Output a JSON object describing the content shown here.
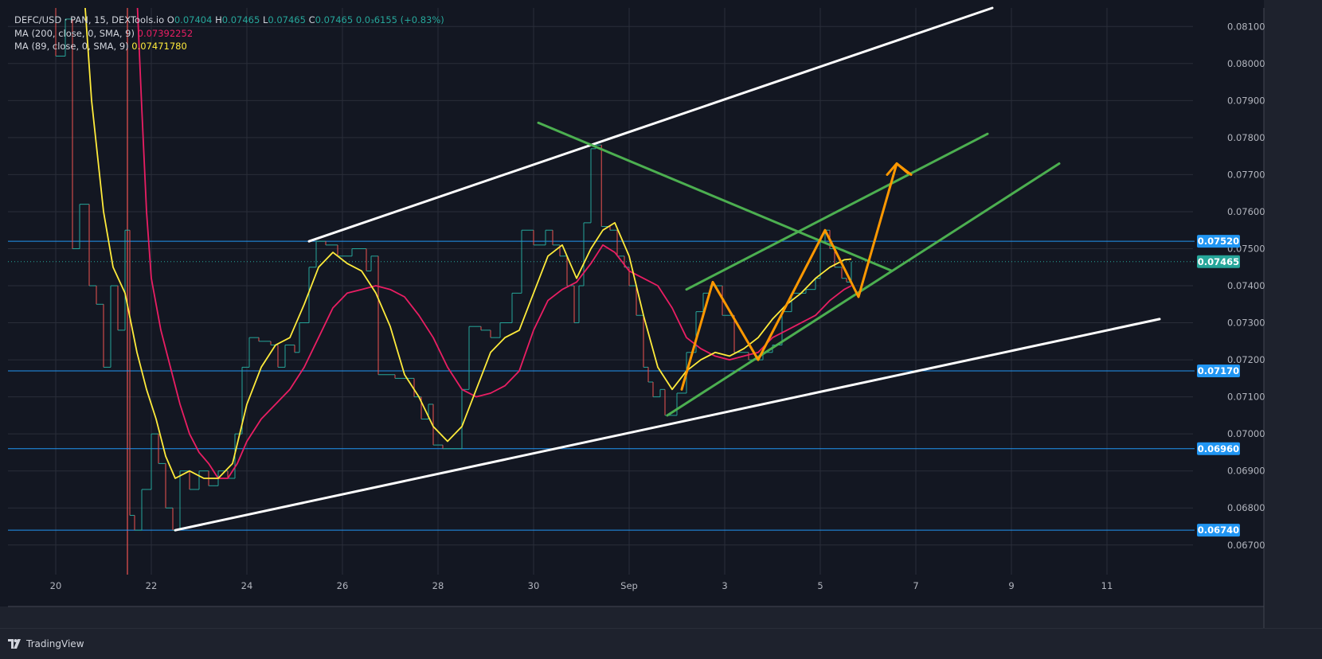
{
  "legend": {
    "symbol": "DEFC/USD · PAN, 15, DEXTools.io",
    "o_label": "O",
    "o": "0.07404",
    "h_label": "H",
    "h": "0.07465",
    "l_label": "L",
    "l": "0.07465",
    "c_label": "C",
    "c": "0.07465",
    "change": "0.0₃6155 (+0.83%)",
    "ma200_label": "MA (200, close, 0, SMA, 9)",
    "ma200_value": "0.07392252",
    "ma89_label": "MA (89, close, 0, SMA, 9)",
    "ma89_value": "0.07471780"
  },
  "branding": {
    "name": "TradingView"
  },
  "colors": {
    "background": "#131722",
    "grid": "#2a2e39",
    "up": "#26a69a",
    "down": "#ef5350",
    "ma200": "#e91e63",
    "ma89": "#ffeb3b",
    "trendline_white": "#ffffff",
    "trendline_green": "#4caf50",
    "projection_orange": "#ff9800",
    "hline": "#2196f3",
    "last_price_bg": "#26a69a"
  },
  "chart_data": {
    "type": "line",
    "x_ticks": [
      "20",
      "22",
      "24",
      "26",
      "28",
      "30",
      "Sep",
      "3",
      "5",
      "7",
      "9",
      "11"
    ],
    "y_ticks": [
      "0.06700",
      "0.06800",
      "0.06900",
      "0.07000",
      "0.07100",
      "0.07200",
      "0.07300",
      "0.07400",
      "0.07500",
      "0.07600",
      "0.07700",
      "0.07800",
      "0.07900",
      "0.08000",
      "0.08100"
    ],
    "ylim": [
      0.0662,
      0.0815
    ],
    "xlim": [
      19.0,
      43.8
    ],
    "horizontal_levels": [
      0.0752,
      0.0717,
      0.0696,
      0.0674
    ],
    "level_labels": [
      "0.07520",
      "0.07170",
      "0.06960",
      "0.06740"
    ],
    "last_price": 0.07465,
    "last_price_label": "0.07465",
    "series": [
      {
        "name": "DEFC/USD",
        "style": "step",
        "points": [
          [
            19.9,
            0.0818
          ],
          [
            20.0,
            0.0802
          ],
          [
            20.2,
            0.0812
          ],
          [
            20.35,
            0.075
          ],
          [
            20.5,
            0.0762
          ],
          [
            20.7,
            0.074
          ],
          [
            20.85,
            0.0735
          ],
          [
            21.0,
            0.0718
          ],
          [
            21.15,
            0.074
          ],
          [
            21.3,
            0.0728
          ],
          [
            21.45,
            0.0755
          ],
          [
            21.55,
            0.0678
          ],
          [
            21.65,
            0.0674
          ],
          [
            21.8,
            0.0685
          ],
          [
            22.0,
            0.07
          ],
          [
            22.15,
            0.0692
          ],
          [
            22.3,
            0.068
          ],
          [
            22.45,
            0.0674
          ],
          [
            22.6,
            0.069
          ],
          [
            22.8,
            0.0685
          ],
          [
            23.0,
            0.069
          ],
          [
            23.2,
            0.0686
          ],
          [
            23.4,
            0.069
          ],
          [
            23.6,
            0.0688
          ],
          [
            23.75,
            0.07
          ],
          [
            23.9,
            0.0718
          ],
          [
            24.05,
            0.0726
          ],
          [
            24.25,
            0.0725
          ],
          [
            24.5,
            0.0724
          ],
          [
            24.65,
            0.0718
          ],
          [
            24.8,
            0.0724
          ],
          [
            25.0,
            0.0722
          ],
          [
            25.1,
            0.073
          ],
          [
            25.3,
            0.0745
          ],
          [
            25.45,
            0.0752
          ],
          [
            25.65,
            0.0751
          ],
          [
            25.9,
            0.0748
          ],
          [
            26.2,
            0.075
          ],
          [
            26.5,
            0.0744
          ],
          [
            26.6,
            0.0748
          ],
          [
            26.75,
            0.0716
          ],
          [
            27.1,
            0.0715
          ],
          [
            27.5,
            0.071
          ],
          [
            27.65,
            0.0704
          ],
          [
            27.8,
            0.0708
          ],
          [
            27.9,
            0.0697
          ],
          [
            28.1,
            0.0696
          ],
          [
            28.4,
            0.0696
          ],
          [
            28.5,
            0.0712
          ],
          [
            28.65,
            0.0729
          ],
          [
            28.9,
            0.0728
          ],
          [
            29.1,
            0.0726
          ],
          [
            29.3,
            0.073
          ],
          [
            29.55,
            0.0738
          ],
          [
            29.75,
            0.0755
          ],
          [
            30.0,
            0.0751
          ],
          [
            30.25,
            0.0755
          ],
          [
            30.4,
            0.0751
          ],
          [
            30.55,
            0.0748
          ],
          [
            30.7,
            0.074
          ],
          [
            30.85,
            0.073
          ],
          [
            30.95,
            0.074
          ],
          [
            31.05,
            0.0757
          ],
          [
            31.2,
            0.0777
          ],
          [
            31.3,
            0.0778
          ],
          [
            31.42,
            0.0756
          ],
          [
            31.6,
            0.0755
          ],
          [
            31.75,
            0.0748
          ],
          [
            31.9,
            0.0745
          ],
          [
            32.0,
            0.074
          ],
          [
            32.15,
            0.0732
          ],
          [
            32.3,
            0.0718
          ],
          [
            32.4,
            0.0714
          ],
          [
            32.5,
            0.071
          ],
          [
            32.65,
            0.0712
          ],
          [
            32.75,
            0.0705
          ],
          [
            33.0,
            0.0711
          ],
          [
            33.2,
            0.0722
          ],
          [
            33.4,
            0.0733
          ],
          [
            33.55,
            0.0738
          ],
          [
            33.7,
            0.074
          ],
          [
            33.95,
            0.0732
          ],
          [
            34.2,
            0.0722
          ],
          [
            34.5,
            0.072
          ],
          [
            34.8,
            0.0722
          ],
          [
            35.0,
            0.0724
          ],
          [
            35.2,
            0.0733
          ],
          [
            35.4,
            0.0738
          ],
          [
            35.7,
            0.0739
          ],
          [
            35.9,
            0.0742
          ],
          [
            36.0,
            0.0752
          ],
          [
            36.1,
            0.0755
          ],
          [
            36.2,
            0.075
          ],
          [
            36.3,
            0.0745
          ],
          [
            36.45,
            0.0742
          ],
          [
            36.55,
            0.0741
          ],
          [
            36.65,
            0.07465
          ]
        ]
      },
      {
        "name": "MA (200, close, 0, SMA, 9)",
        "style": "line",
        "points": [
          [
            21.7,
            0.0818
          ],
          [
            21.8,
            0.0788
          ],
          [
            21.9,
            0.076
          ],
          [
            22.0,
            0.0742
          ],
          [
            22.2,
            0.0728
          ],
          [
            22.4,
            0.0718
          ],
          [
            22.6,
            0.0708
          ],
          [
            22.8,
            0.07
          ],
          [
            23.0,
            0.0695
          ],
          [
            23.2,
            0.0692
          ],
          [
            23.4,
            0.0688
          ],
          [
            23.6,
            0.0688
          ],
          [
            23.8,
            0.0692
          ],
          [
            24.0,
            0.0698
          ],
          [
            24.3,
            0.0704
          ],
          [
            24.6,
            0.0708
          ],
          [
            24.9,
            0.0712
          ],
          [
            25.2,
            0.0718
          ],
          [
            25.5,
            0.0726
          ],
          [
            25.8,
            0.0734
          ],
          [
            26.1,
            0.0738
          ],
          [
            26.4,
            0.0739
          ],
          [
            26.7,
            0.074
          ],
          [
            27.0,
            0.0739
          ],
          [
            27.3,
            0.0737
          ],
          [
            27.6,
            0.0732
          ],
          [
            27.9,
            0.0726
          ],
          [
            28.2,
            0.0718
          ],
          [
            28.5,
            0.0712
          ],
          [
            28.8,
            0.071
          ],
          [
            29.1,
            0.0711
          ],
          [
            29.4,
            0.0713
          ],
          [
            29.7,
            0.0717
          ],
          [
            30.0,
            0.0728
          ],
          [
            30.3,
            0.0736
          ],
          [
            30.6,
            0.0739
          ],
          [
            30.9,
            0.0741
          ],
          [
            31.2,
            0.0746
          ],
          [
            31.45,
            0.0751
          ],
          [
            31.7,
            0.0749
          ],
          [
            32.0,
            0.0744
          ],
          [
            32.3,
            0.0742
          ],
          [
            32.6,
            0.074
          ],
          [
            32.9,
            0.0734
          ],
          [
            33.2,
            0.0726
          ],
          [
            33.5,
            0.0723
          ],
          [
            33.8,
            0.0721
          ],
          [
            34.1,
            0.072
          ],
          [
            34.4,
            0.0721
          ],
          [
            34.7,
            0.0722
          ],
          [
            35.0,
            0.0726
          ],
          [
            35.3,
            0.0728
          ],
          [
            35.6,
            0.073
          ],
          [
            35.9,
            0.0732
          ],
          [
            36.2,
            0.0736
          ],
          [
            36.5,
            0.0739
          ],
          [
            36.65,
            0.074
          ]
        ]
      },
      {
        "name": "MA (89, close, 0, SMA, 9)",
        "style": "line",
        "points": [
          [
            20.6,
            0.0818
          ],
          [
            20.75,
            0.079
          ],
          [
            21.0,
            0.076
          ],
          [
            21.2,
            0.0745
          ],
          [
            21.45,
            0.0738
          ],
          [
            21.7,
            0.0722
          ],
          [
            21.9,
            0.0712
          ],
          [
            22.1,
            0.0704
          ],
          [
            22.3,
            0.0694
          ],
          [
            22.5,
            0.0688
          ],
          [
            22.8,
            0.069
          ],
          [
            23.1,
            0.0688
          ],
          [
            23.4,
            0.0688
          ],
          [
            23.7,
            0.0692
          ],
          [
            24.0,
            0.0708
          ],
          [
            24.3,
            0.0718
          ],
          [
            24.6,
            0.0724
          ],
          [
            24.9,
            0.0726
          ],
          [
            25.2,
            0.0735
          ],
          [
            25.5,
            0.0745
          ],
          [
            25.8,
            0.0749
          ],
          [
            26.1,
            0.0746
          ],
          [
            26.4,
            0.0744
          ],
          [
            26.7,
            0.0738
          ],
          [
            27.0,
            0.0729
          ],
          [
            27.3,
            0.0716
          ],
          [
            27.6,
            0.071
          ],
          [
            27.9,
            0.0702
          ],
          [
            28.2,
            0.0698
          ],
          [
            28.5,
            0.0702
          ],
          [
            28.8,
            0.0712
          ],
          [
            29.1,
            0.0722
          ],
          [
            29.4,
            0.0726
          ],
          [
            29.7,
            0.0728
          ],
          [
            30.0,
            0.0738
          ],
          [
            30.3,
            0.0748
          ],
          [
            30.6,
            0.0751
          ],
          [
            30.9,
            0.0742
          ],
          [
            31.2,
            0.075
          ],
          [
            31.45,
            0.0755
          ],
          [
            31.7,
            0.0757
          ],
          [
            32.0,
            0.0748
          ],
          [
            32.3,
            0.0732
          ],
          [
            32.6,
            0.0718
          ],
          [
            32.9,
            0.0712
          ],
          [
            33.2,
            0.0717
          ],
          [
            33.5,
            0.072
          ],
          [
            33.8,
            0.0722
          ],
          [
            34.1,
            0.0721
          ],
          [
            34.4,
            0.0723
          ],
          [
            34.7,
            0.0726
          ],
          [
            35.0,
            0.0731
          ],
          [
            35.3,
            0.0735
          ],
          [
            35.6,
            0.0738
          ],
          [
            35.9,
            0.0742
          ],
          [
            36.2,
            0.0745
          ],
          [
            36.5,
            0.0747
          ],
          [
            36.65,
            0.07472
          ]
        ]
      }
    ],
    "drawings": [
      {
        "color": "white",
        "points": [
          [
            22.5,
            0.0674
          ],
          [
            43.1,
            0.0731
          ]
        ]
      },
      {
        "color": "white",
        "points": [
          [
            25.3,
            0.0752
          ],
          [
            39.6,
            0.0815
          ]
        ]
      },
      {
        "color": "green",
        "points": [
          [
            30.1,
            0.0784
          ],
          [
            37.5,
            0.0744
          ]
        ]
      },
      {
        "color": "green",
        "points": [
          [
            33.2,
            0.0739
          ],
          [
            39.5,
            0.0781
          ]
        ]
      },
      {
        "color": "green",
        "points": [
          [
            32.8,
            0.0705
          ],
          [
            41.0,
            0.0773
          ]
        ]
      },
      {
        "color": "orange",
        "points": [
          [
            33.1,
            0.0712
          ],
          [
            33.75,
            0.0741
          ],
          [
            34.7,
            0.072
          ],
          [
            36.1,
            0.0755
          ],
          [
            36.8,
            0.0737
          ],
          [
            37.6,
            0.0773
          ],
          [
            37.9,
            0.077
          ]
        ]
      }
    ]
  }
}
